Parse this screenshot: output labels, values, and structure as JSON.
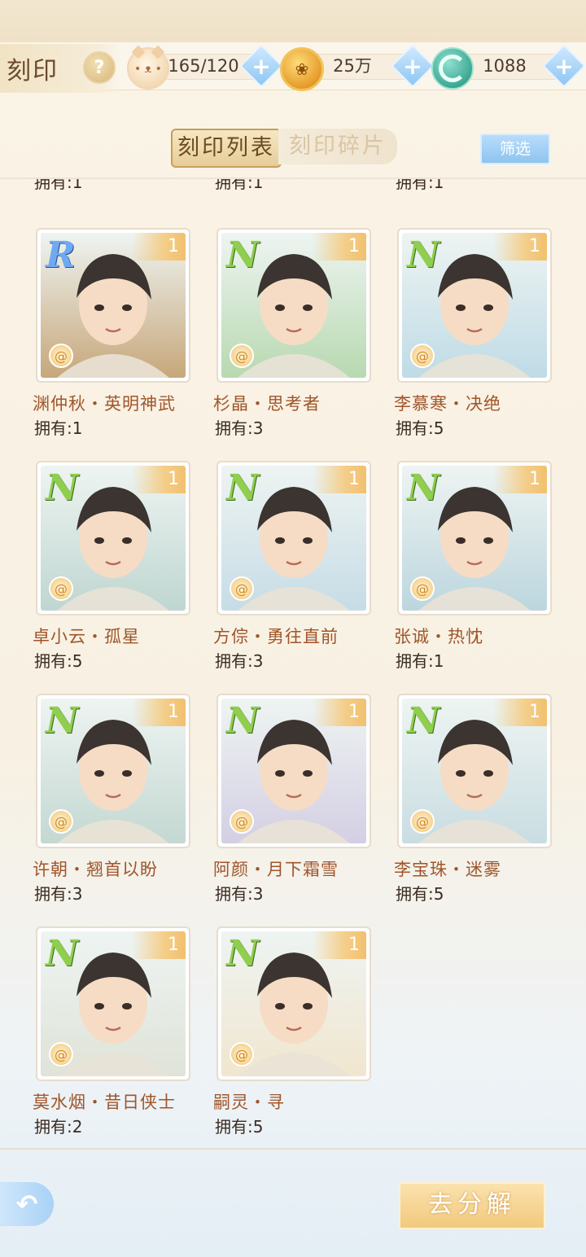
{
  "header": {
    "title": "刻印",
    "help_glyph": "?",
    "resources": [
      {
        "icon": "cat-stamina-icon",
        "value": "165/120"
      },
      {
        "icon": "paw-coin-icon",
        "value": "25万"
      },
      {
        "icon": "jade-ring-icon",
        "value": "1088"
      }
    ],
    "plus_glyph": "+"
  },
  "tabs": [
    {
      "label": "刻印列表",
      "active": true
    },
    {
      "label": "刻印碎片",
      "active": false
    }
  ],
  "filter_label": "筛选",
  "partial_row": [
    "拥有:1",
    "拥有:1",
    "拥有:1"
  ],
  "cards": [
    {
      "rarity": "R",
      "level": "1",
      "name": "渊仲秋・英明神武",
      "owned": "拥有:1",
      "theme": "#c7a77a"
    },
    {
      "rarity": "N",
      "level": "1",
      "name": "杉晶・思考者",
      "owned": "拥有:3",
      "theme": "#b8d9b0"
    },
    {
      "rarity": "N",
      "level": "1",
      "name": "李慕寒・决绝",
      "owned": "拥有:5",
      "theme": "#bfdbe6"
    },
    {
      "rarity": "N",
      "level": "1",
      "name": "卓小云・孤星",
      "owned": "拥有:5",
      "theme": "#bfd6d0"
    },
    {
      "rarity": "N",
      "level": "1",
      "name": "方倧・勇往直前",
      "owned": "拥有:3",
      "theme": "#c6dce6"
    },
    {
      "rarity": "N",
      "level": "1",
      "name": "张诚・热忱",
      "owned": "拥有:1",
      "theme": "#bcd6de"
    },
    {
      "rarity": "N",
      "level": "1",
      "name": "许朝・翘首以盼",
      "owned": "拥有:3",
      "theme": "#c4d8d2"
    },
    {
      "rarity": "N",
      "level": "1",
      "name": "阿颜・月下霜雪",
      "owned": "拥有:3",
      "theme": "#d4cfe4"
    },
    {
      "rarity": "N",
      "level": "1",
      "name": "李宝珠・迷雾",
      "owned": "拥有:5",
      "theme": "#c9dde2"
    },
    {
      "rarity": "N",
      "level": "1",
      "name": "莫水烟・昔日侠士",
      "owned": "拥有:2",
      "theme": "#dfe3d8"
    },
    {
      "rarity": "N",
      "level": "1",
      "name": "嗣灵・寻",
      "owned": "拥有:5",
      "theme": "#f1e6cf"
    }
  ],
  "swirl_glyph": "@",
  "back_glyph": "↶",
  "decompose_label": "去分解"
}
